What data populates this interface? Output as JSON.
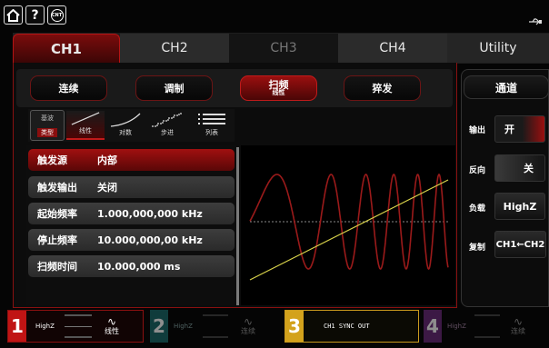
{
  "topbar": {
    "home_icon": "home-icon",
    "help_label": "?",
    "cnt_label": "CNT",
    "status_icon": "usb-icon"
  },
  "tabs": [
    {
      "label": "CH1"
    },
    {
      "label": "CH2"
    },
    {
      "label": "CH3"
    },
    {
      "label": "CH4"
    },
    {
      "label": "Utility"
    }
  ],
  "modes": [
    {
      "label": "连续"
    },
    {
      "label": "调制"
    },
    {
      "label": "扫频",
      "sub": "线性"
    },
    {
      "label": "猝发"
    }
  ],
  "subtabs": {
    "basic": "基波",
    "type": "类型",
    "items": [
      {
        "label": "线性"
      },
      {
        "label": "对数"
      },
      {
        "label": "步进"
      },
      {
        "label": "列表"
      }
    ]
  },
  "params": [
    {
      "label": "触发源",
      "value": "内部"
    },
    {
      "label": "触发输出",
      "value": "关闭"
    },
    {
      "label": "起始频率",
      "value": "1.000,000,000 kHz"
    },
    {
      "label": "停止频率",
      "value": "10.000,000,00 kHz"
    },
    {
      "label": "扫频时间",
      "value": "10.000,000 ms"
    }
  ],
  "right": {
    "title": "通道",
    "output_label": "输出",
    "output_value": "开",
    "invert_label": "反向",
    "invert_value": "关",
    "load_label": "负载",
    "load_value": "HighZ",
    "copy_label": "复制",
    "copy_value": "CH1←CH2"
  },
  "bottom": [
    {
      "num": "1",
      "load": "HighZ",
      "mode": "线性"
    },
    {
      "num": "2",
      "load": "HighZ",
      "mode": "连续"
    },
    {
      "num": "3",
      "text": "CH1 SYNC OUT"
    },
    {
      "num": "4",
      "load": "HighZ",
      "mode": "连续"
    }
  ],
  "colors": {
    "accent": "#b51414",
    "tab_active": "#7a0c0c",
    "highlight": "#c99a1e",
    "sweep_line": "#d8d24a",
    "wave": "#9a1a1a"
  }
}
